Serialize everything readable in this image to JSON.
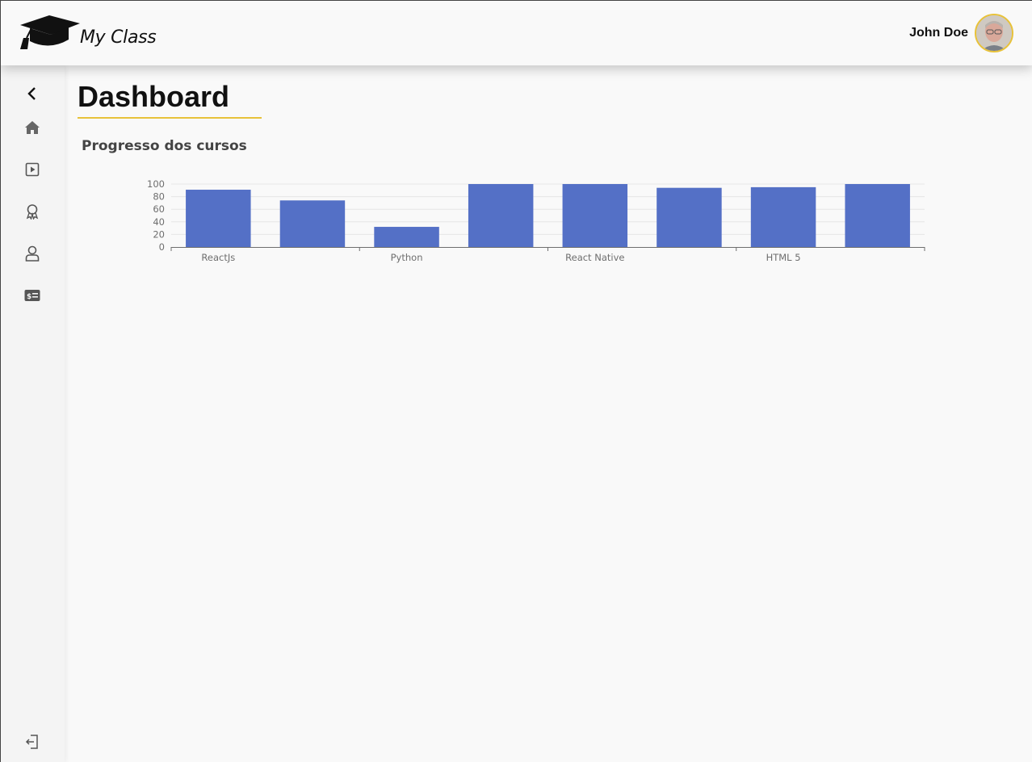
{
  "brand": {
    "name": "My Class"
  },
  "user": {
    "name": "John Doe"
  },
  "sidebar": {
    "items": [
      {
        "icon": "chevron-left-icon"
      },
      {
        "icon": "home-icon"
      },
      {
        "icon": "video-play-icon"
      },
      {
        "icon": "award-icon"
      },
      {
        "icon": "user-icon"
      },
      {
        "icon": "money-card-icon"
      }
    ],
    "logout_icon": "logout-icon"
  },
  "page": {
    "title": "Dashboard",
    "section_title": "Progresso dos cursos"
  },
  "colors": {
    "accent": "#e8c23a",
    "bar": "#5470c6"
  },
  "chart_data": {
    "type": "bar",
    "categories": [
      "ReactJs",
      "",
      "Python",
      "",
      "React Native",
      "",
      "HTML 5",
      ""
    ],
    "series": [
      {
        "values": [
          91,
          74,
          32,
          100,
          100,
          94,
          95,
          100
        ]
      }
    ],
    "y_ticks": [
      "0",
      "20",
      "40",
      "60",
      "80",
      "100"
    ],
    "ylim": [
      0,
      100
    ],
    "grid": true
  }
}
